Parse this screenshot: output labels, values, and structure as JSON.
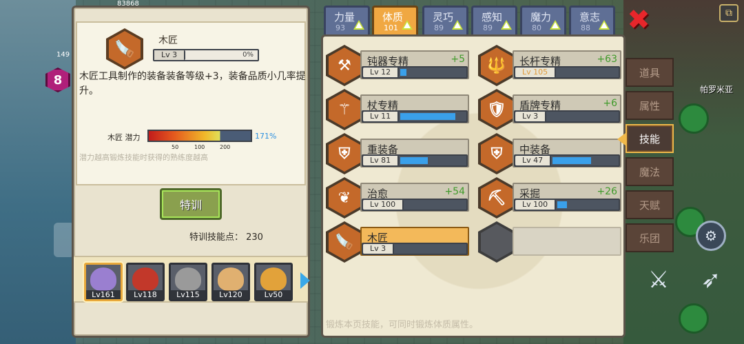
{
  "hud": {
    "gold": "83868",
    "gem_count": "149",
    "badge_number": "8",
    "map_label": "帕罗米亚",
    "close_glyph": "✖",
    "corner_glyph": "⧉"
  },
  "detail": {
    "skill_name": "木匠",
    "level": "Lv 3",
    "progress_text": "0%",
    "progress_fraction": 0.0,
    "description": "木匠工具制作的装备装备等级+3，装备品质小几率提升。",
    "potential_label": "木匠 潜力",
    "potential_percent": "171%",
    "potential_ticks": [
      "50",
      "100",
      "200"
    ],
    "hint": "潜力越高锻炼技能时获得的熟练度越高",
    "train_button": "特训",
    "train_points": "特训技能点：  230",
    "icon_glyph": "🪚"
  },
  "heroes": [
    {
      "level": "Lv161",
      "selected": true,
      "color": "#9a7fd0"
    },
    {
      "level": "Lv118",
      "selected": false,
      "color": "#c2382a"
    },
    {
      "level": "Lv115",
      "selected": false,
      "color": "#9a9a9a"
    },
    {
      "level": "Lv120",
      "selected": false,
      "color": "#e0b070"
    },
    {
      "level": "Lv50",
      "selected": false,
      "color": "#e2a23a"
    }
  ],
  "stat_tabs": [
    {
      "name": "力量",
      "value": "93",
      "active": false
    },
    {
      "name": "体质",
      "value": "101",
      "active": true
    },
    {
      "name": "灵巧",
      "value": "89",
      "active": false
    },
    {
      "name": "感知",
      "value": "89",
      "active": false
    },
    {
      "name": "魔力",
      "value": "80",
      "active": false
    },
    {
      "name": "意志",
      "value": "88",
      "active": false
    }
  ],
  "skills": [
    {
      "name": "钝器专精",
      "bonus": "+5",
      "level": "Lv 12",
      "progress": 0.1,
      "icon": "⚒"
    },
    {
      "name": "长杆专精",
      "bonus": "+63",
      "level": "Lv 105",
      "progress": 0.0,
      "icon": "🔱"
    },
    {
      "name": "杖专精",
      "bonus": "",
      "level": "Lv 11",
      "progress": 0.85,
      "icon": "⚚"
    },
    {
      "name": "盾牌专精",
      "bonus": "+6",
      "level": "Lv 3",
      "progress": 0.0,
      "icon": "🛡"
    },
    {
      "name": "重装备",
      "bonus": "",
      "level": "Lv 81",
      "progress": 0.43,
      "icon": "⛨"
    },
    {
      "name": "中装备",
      "bonus": "",
      "level": "Lv 47",
      "progress": 0.6,
      "icon": "⛨"
    },
    {
      "name": "治愈",
      "bonus": "+54",
      "level": "Lv 100",
      "progress": 0.0,
      "icon": "❦"
    },
    {
      "name": "采掘",
      "bonus": "+26",
      "level": "Lv 100",
      "progress": 0.16,
      "icon": "⛏"
    },
    {
      "name": "木匠",
      "bonus": "",
      "level": "Lv 3",
      "progress": 0.0,
      "icon": "🪚",
      "highlight": true
    }
  ],
  "footer_hint": "锻炼本页技能，可同时锻炼体质属性。",
  "side_menu": [
    {
      "label": "道具",
      "active": false
    },
    {
      "label": "属性",
      "active": false
    },
    {
      "label": "技能",
      "active": true
    },
    {
      "label": "魔法",
      "active": false
    },
    {
      "label": "天赋",
      "active": false
    },
    {
      "label": "乐团",
      "active": false
    }
  ],
  "colors": {
    "accent_orange": "#f0a842",
    "progress_blue": "#3aa0ea",
    "bonus_green": "#3f9a2a",
    "stat_tab_blue": "#5f6f95",
    "close_red": "#e8262b"
  }
}
